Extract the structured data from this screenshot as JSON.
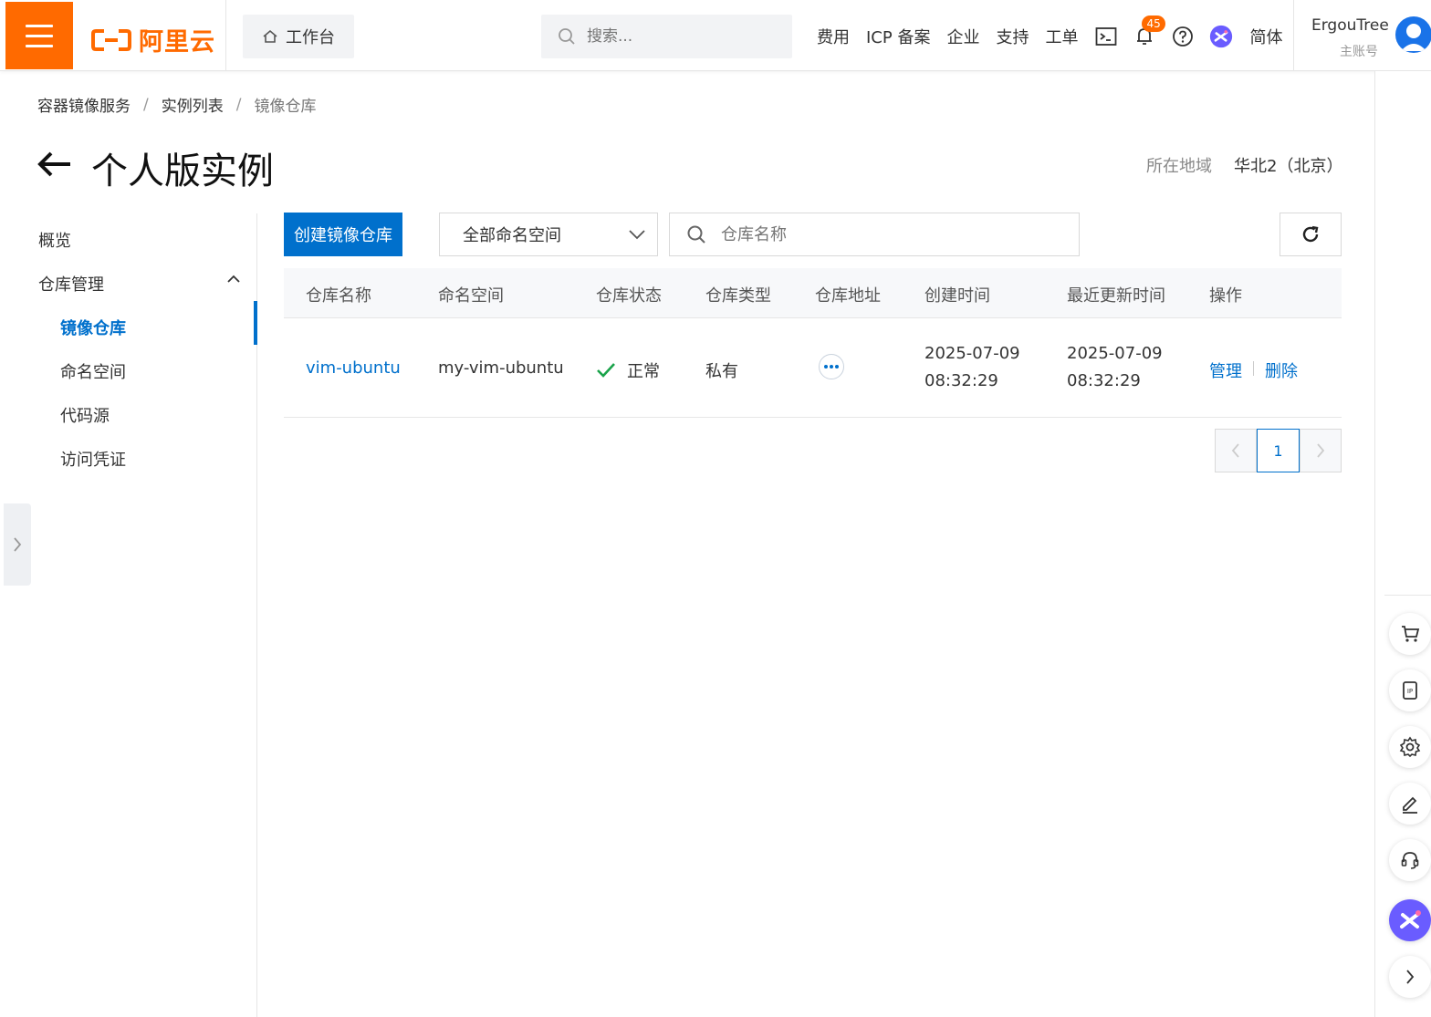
{
  "topbar": {
    "logo_text": "阿里云",
    "workbench_label": "工作台",
    "search_placeholder": "搜索...",
    "nav_links": [
      "费用",
      "ICP 备案",
      "企业",
      "支持",
      "工单"
    ],
    "notification_count": "45",
    "language": "简体",
    "user_name": "ErgouTree",
    "user_role": "主账号",
    "brand_color": "#ff6a00"
  },
  "breadcrumb": [
    "容器镜像服务",
    "实例列表",
    "镜像仓库"
  ],
  "page": {
    "title": "个人版实例",
    "region_label": "所在地域",
    "region_value": "华北2（北京）"
  },
  "sidebar": {
    "overview": "概览",
    "group_label": "仓库管理",
    "items": [
      "镜像仓库",
      "命名空间",
      "代码源",
      "访问凭证"
    ],
    "active_item": "镜像仓库"
  },
  "toolbar": {
    "create_button": "创建镜像仓库",
    "namespace_select": "全部命名空间",
    "repo_search_placeholder": "仓库名称"
  },
  "table": {
    "headers": [
      "仓库名称",
      "命名空间",
      "仓库状态",
      "仓库类型",
      "仓库地址",
      "创建时间",
      "最近更新时间",
      "操作"
    ],
    "rows": [
      {
        "name": "vim-ubuntu",
        "namespace": "my-vim-ubuntu",
        "status": "正常",
        "type": "私有",
        "created_date": "2025-07-09",
        "created_time": "08:32:29",
        "updated_date": "2025-07-09",
        "updated_time": "08:32:29",
        "action_manage": "管理",
        "action_delete": "删除"
      }
    ]
  },
  "pagination": {
    "current_page": "1"
  },
  "accent_color": "#0070cc"
}
